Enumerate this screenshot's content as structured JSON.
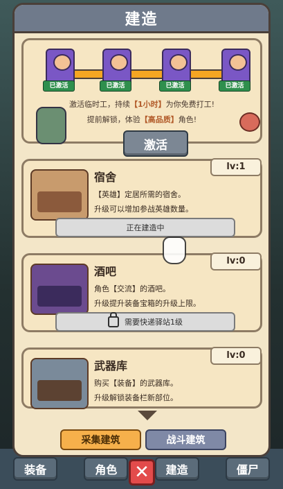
{
  "bottom_nav": {
    "tabs": [
      "装备",
      "角色",
      "建造",
      "僵尸"
    ]
  },
  "panel": {
    "title": "建造",
    "promo": {
      "badges": [
        "已激活",
        "已激活",
        "已激活",
        "已激活"
      ],
      "line1_prefix": "激活临时工，持续",
      "line1_highlight": "【1小时】",
      "line1_suffix": "为你免费打工!",
      "line2_prefix": "提前解锁，体验",
      "line2_highlight": "【高品质】",
      "line2_suffix": "角色!",
      "activate_label": "激活"
    },
    "buildings": [
      {
        "title": "宿舍",
        "level": "lv:1",
        "desc_line1": "【英雄】定居所需的宿舍。",
        "desc_line2": "升级可以增加参战英雄数量。",
        "button_label": "正在建造中"
      },
      {
        "title": "酒吧",
        "level": "lv:0",
        "desc_line1": "角色【交流】的酒吧。",
        "desc_line2": "升级提升装备宝箱的升级上限。",
        "button_label": "需要快递驿站1级"
      },
      {
        "title": "武器库",
        "level": "lv:0",
        "desc_line1": "购买【装备】的武器库。",
        "desc_line2": "升级解锁装备栏新部位。"
      }
    ],
    "tabs": [
      "采集建筑",
      "战斗建筑"
    ]
  }
}
